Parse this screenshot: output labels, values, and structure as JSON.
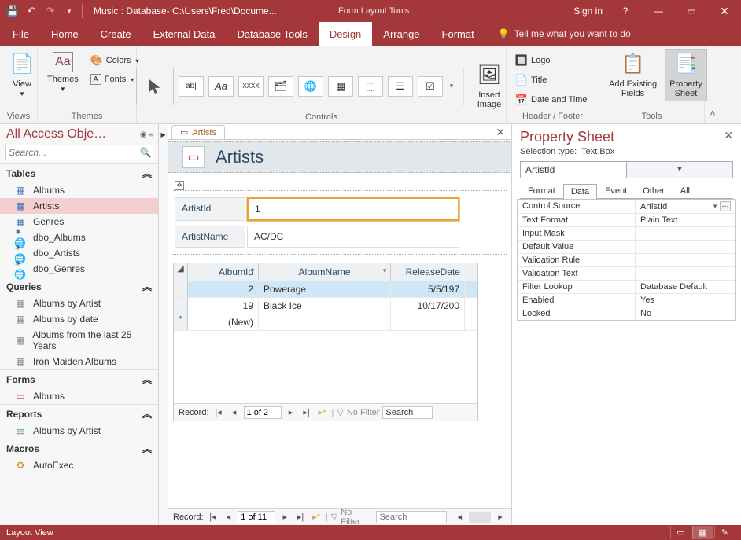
{
  "titlebar": {
    "doc_title": "Music : Database- C:\\Users\\Fred\\Docume...",
    "contextual": "Form Layout Tools",
    "signin": "Sign in"
  },
  "tabs": {
    "file": "File",
    "home": "Home",
    "create": "Create",
    "external": "External Data",
    "dbtools": "Database Tools",
    "design": "Design",
    "arrange": "Arrange",
    "format": "Format",
    "tellme": "Tell me what you want to do"
  },
  "ribbon": {
    "views": {
      "label": "Views",
      "view": "View"
    },
    "themes": {
      "label": "Themes",
      "themes": "Themes",
      "colors": "Colors",
      "fonts": "Fonts"
    },
    "controls": {
      "label": "Controls",
      "insert_image": "Insert\nImage"
    },
    "headerfooter": {
      "label": "Header / Footer",
      "logo": "Logo",
      "title": "Title",
      "datetime": "Date and Time"
    },
    "tools": {
      "label": "Tools",
      "addfields": "Add Existing\nFields",
      "propsheet": "Property\nSheet"
    }
  },
  "nav": {
    "title": "All Access Obje…",
    "search_ph": "Search...",
    "sections": {
      "tables": "Tables",
      "queries": "Queries",
      "forms": "Forms",
      "reports": "Reports",
      "macros": "Macros"
    },
    "tables": [
      "Albums",
      "Artists",
      "Genres",
      "dbo_Albums",
      "dbo_Artists",
      "dbo_Genres"
    ],
    "queries": [
      "Albums by Artist",
      "Albums by date",
      "Albums from the last 25 Years",
      "Iron Maiden Albums"
    ],
    "forms": [
      "Albums"
    ],
    "reports": [
      "Albums by Artist"
    ],
    "macros": [
      "AutoExec"
    ]
  },
  "doc": {
    "tab": "Artists",
    "form_title": "Artists",
    "fields": {
      "artistid_label": "ArtistId",
      "artistid_value": "1",
      "artistname_label": "ArtistName",
      "artistname_value": "AC/DC"
    },
    "subform": {
      "cols": {
        "id": "AlbumId",
        "name": "AlbumName",
        "date": "ReleaseDate"
      },
      "rows": [
        {
          "id": "2",
          "name": "Powerage",
          "date": "5/5/197"
        },
        {
          "id": "19",
          "name": "Black Ice",
          "date": "10/17/200"
        }
      ],
      "new": "(New)",
      "recnav": {
        "label": "Record:",
        "pos": "1 of 2",
        "nofilter": "No Filter",
        "search": "Search"
      }
    },
    "recnav": {
      "label": "Record:",
      "pos": "1 of 11",
      "nofilter": "No Filter",
      "search": "Search"
    }
  },
  "props": {
    "title": "Property Sheet",
    "seltype_label": "Selection type:",
    "seltype_value": "Text Box",
    "object": "ArtistId",
    "tabs": {
      "format": "Format",
      "data": "Data",
      "event": "Event",
      "other": "Other",
      "all": "All"
    },
    "rows": [
      {
        "k": "Control Source",
        "v": "ArtistId",
        "dd": true,
        "bld": true
      },
      {
        "k": "Text Format",
        "v": "Plain Text"
      },
      {
        "k": "Input Mask",
        "v": ""
      },
      {
        "k": "Default Value",
        "v": ""
      },
      {
        "k": "Validation Rule",
        "v": ""
      },
      {
        "k": "Validation Text",
        "v": ""
      },
      {
        "k": "Filter Lookup",
        "v": "Database Default"
      },
      {
        "k": "Enabled",
        "v": "Yes"
      },
      {
        "k": "Locked",
        "v": "No"
      }
    ]
  },
  "status": {
    "label": "Layout View"
  }
}
